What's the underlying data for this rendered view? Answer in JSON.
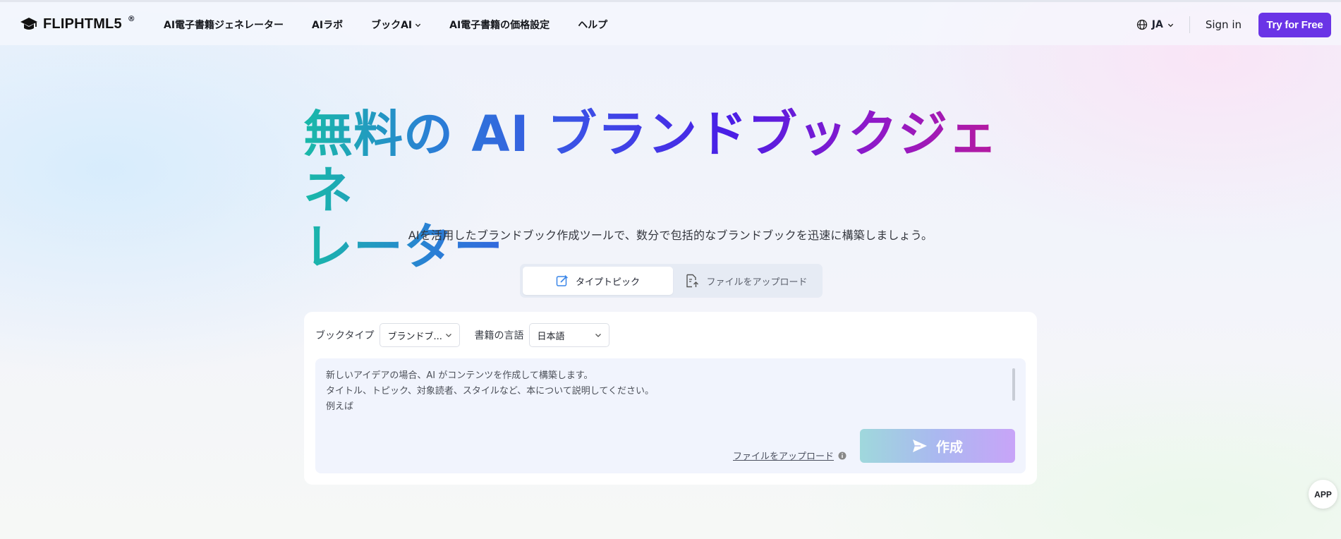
{
  "nav": {
    "logo_text": "FLIPHTML5",
    "logo_reg": "®",
    "links": [
      {
        "label": "AI電子書籍ジェネレーター"
      },
      {
        "label": "AIラボ"
      },
      {
        "label": "ブックAI",
        "dropdown": true
      },
      {
        "label": "AI電子書籍の価格設定"
      },
      {
        "label": "ヘルプ"
      }
    ],
    "language": "JA",
    "sign_in": "Sign in",
    "try_free": "Try for Free"
  },
  "hero": {
    "title_line1": "無料の AI ブランドブックジェネ",
    "title_line2": "レーター",
    "subtitle": "AIを活用したブランドブック作成ツールで、数分で包括的なブランドブックを迅速に構築しましょう。"
  },
  "tabs": {
    "type_topic": "タイプトピック",
    "upload_file": "ファイルをアップロード"
  },
  "form": {
    "book_type_label": "ブックタイプ",
    "book_type_value": "ブランドブ...",
    "language_label": "書籍の言語",
    "language_value": "日本語",
    "placeholder": "新しいアイデアの場合、AI がコンテンツを作成して構築します。\nタイトル、トピック、対象読者、スタイルなど、本について説明してください。\n例えば",
    "upload_link": "ファイルをアップロード",
    "create_button": "作成"
  },
  "app_badge": "APP",
  "colors": {
    "accent": "#6a34e6",
    "gradient_start": "#19b9a8",
    "gradient_end": "#c11a92"
  }
}
